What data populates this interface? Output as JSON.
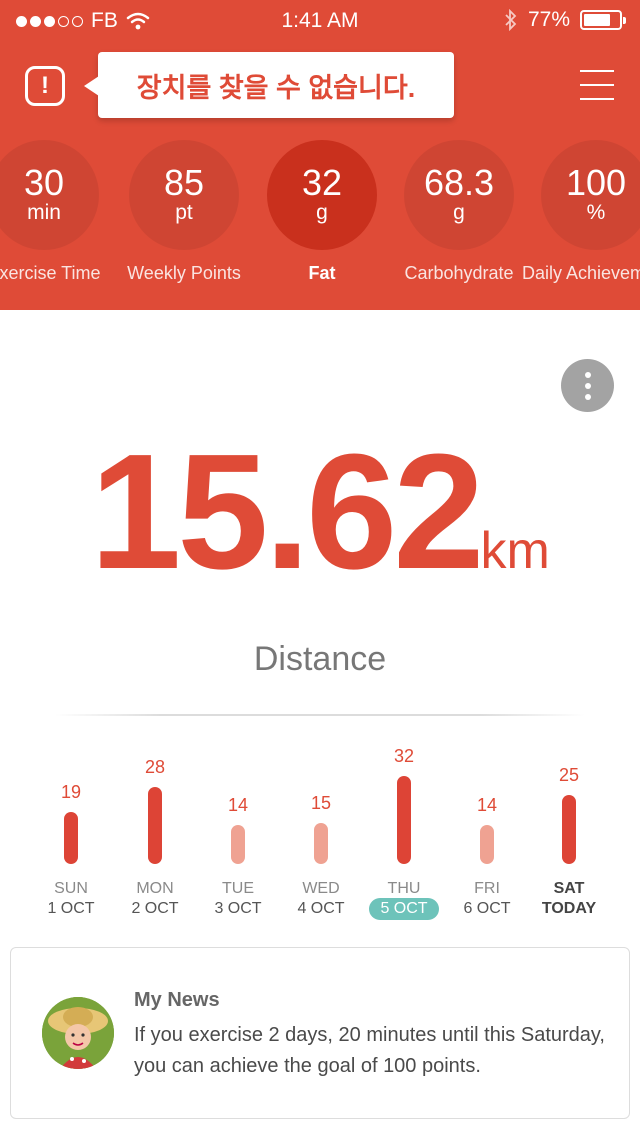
{
  "status_bar": {
    "carrier": "FB",
    "time": "1:41 AM",
    "battery": "77%",
    "battery_level": 0.77,
    "signal_bars_filled": 3,
    "signal_bars_total": 5
  },
  "header": {
    "alert_message": "장치를 찾을 수 없습니다.",
    "metrics": [
      {
        "value": "30",
        "unit": "min",
        "label": "Exercise Time",
        "active": false
      },
      {
        "value": "85",
        "unit": "pt",
        "label": "Weekly Points",
        "active": false
      },
      {
        "value": "32",
        "unit": "g",
        "label": "Fat",
        "active": true
      },
      {
        "value": "68.3",
        "unit": "g",
        "label": "Carbohydrate",
        "active": false
      },
      {
        "value": "100",
        "unit": "%",
        "label": "Daily Achievement",
        "active": false
      }
    ]
  },
  "main": {
    "big_value": "15.62",
    "big_unit": "km",
    "metric_name": "Distance"
  },
  "weekly": {
    "max_value": 32,
    "days": [
      {
        "value": 19,
        "day": "SUN",
        "date": "1 OCT",
        "highlight": true
      },
      {
        "value": 28,
        "day": "MON",
        "date": "2 OCT",
        "highlight": true
      },
      {
        "value": 14,
        "day": "TUE",
        "date": "3 OCT",
        "highlight": false
      },
      {
        "value": 15,
        "day": "WED",
        "date": "4 OCT",
        "highlight": false
      },
      {
        "value": 32,
        "day": "THU",
        "date": "5 OCT",
        "highlight": true,
        "selected": true
      },
      {
        "value": 14,
        "day": "FRI",
        "date": "6 OCT",
        "highlight": false
      },
      {
        "value": 25,
        "day": "SAT",
        "date": "TODAY",
        "highlight": true,
        "today": true
      }
    ]
  },
  "news": {
    "title": "My News",
    "text": "If you exercise 2 days, 20 minutes until this Saturday, you can achieve the goal of 100 points."
  },
  "colors": {
    "accent": "#df4b37",
    "selected_day": "#6dc3ba",
    "bar_light": "#efa292"
  }
}
